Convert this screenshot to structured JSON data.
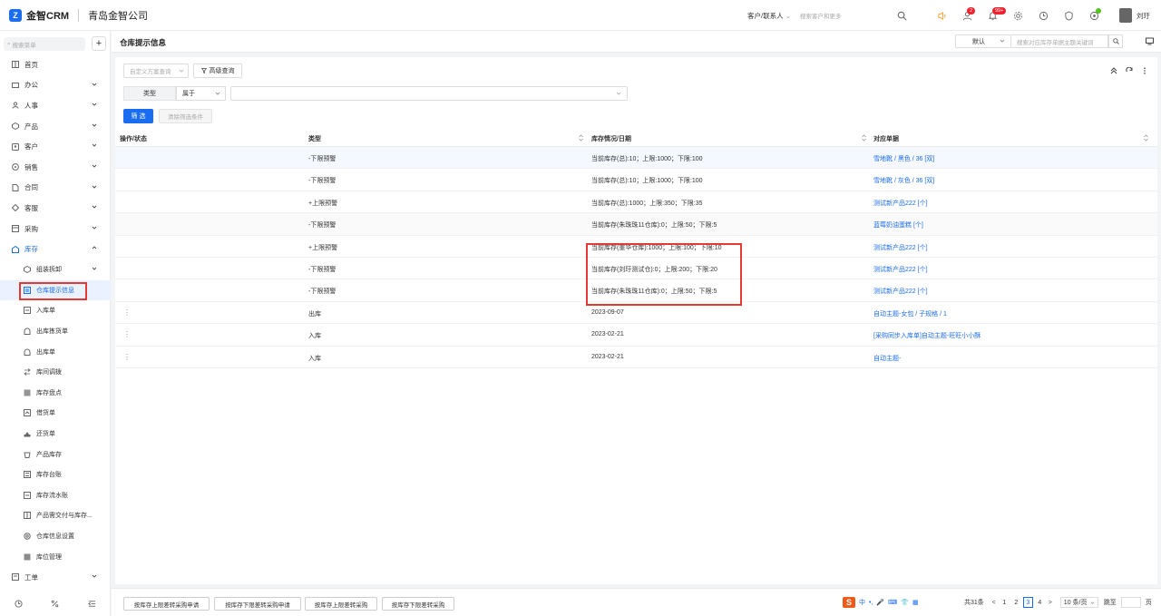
{
  "app": {
    "logo_letter": "Z",
    "brand": "金智CRM",
    "company": "青岛金智公司"
  },
  "topbar": {
    "customer_select": "客户/联系人",
    "search_placeholder": "搜索客户和更多",
    "badge_contacts": "2",
    "badge_notifications": "99+",
    "user_name": "刘玗"
  },
  "sidebar": {
    "search_placeholder": "搜索菜单",
    "plus": "+",
    "items": [
      {
        "label": "首页",
        "icon": "home-icon"
      },
      {
        "label": "办公",
        "icon": "mail-icon"
      },
      {
        "label": "人事",
        "icon": "people-icon"
      },
      {
        "label": "产品",
        "icon": "box-icon"
      },
      {
        "label": "客户",
        "icon": "contact-icon"
      },
      {
        "label": "销售",
        "icon": "sales-icon"
      },
      {
        "label": "合同",
        "icon": "contract-icon"
      },
      {
        "label": "客服",
        "icon": "service-icon"
      },
      {
        "label": "采购",
        "icon": "cart-icon"
      },
      {
        "label": "库存",
        "icon": "warehouse-icon"
      }
    ],
    "sub_items": [
      {
        "label": "组装拆卸",
        "icon": "assembly-icon"
      },
      {
        "label": "仓库提示信息",
        "icon": "alert-doc-icon"
      },
      {
        "label": "入库单",
        "icon": "inbound-icon"
      },
      {
        "label": "出库拣货单",
        "icon": "picking-icon"
      },
      {
        "label": "出库单",
        "icon": "outbound-icon"
      },
      {
        "label": "库间调拨",
        "icon": "transfer-icon"
      },
      {
        "label": "库存盘点",
        "icon": "stocktake-icon"
      },
      {
        "label": "借货单",
        "icon": "borrow-icon"
      },
      {
        "label": "还货单",
        "icon": "return-icon"
      },
      {
        "label": "产品库存",
        "icon": "product-stock-icon"
      },
      {
        "label": "库存台账",
        "icon": "ledger-icon"
      },
      {
        "label": "库存流水账",
        "icon": "journal-icon"
      },
      {
        "label": "产品需交付与库存...",
        "icon": "delivery-icon"
      },
      {
        "label": "仓库信息设置",
        "icon": "settings-icon"
      },
      {
        "label": "库位管理",
        "icon": "location-icon"
      }
    ],
    "last_item": {
      "label": "工单",
      "icon": "ticket-icon"
    }
  },
  "page": {
    "title": "仓库提示信息",
    "view_select": "默认",
    "search_placeholder": "搜索对应库存单据主题关键词",
    "custom_scheme_placeholder": "自定义方案查询",
    "advanced_query": "高级查询",
    "condition": {
      "field": "类型",
      "operator": "属于",
      "value": ""
    },
    "filter_button": "筛 选",
    "clear_button": "清除筛选条件"
  },
  "table": {
    "headers": [
      "操作/状态",
      "类型",
      "库存情况/日期",
      "对应单据"
    ],
    "rows": [
      {
        "action": "",
        "type": "-下限预警",
        "status": "当前库存(总):10；上限:1000；下限:100",
        "doc": "雪地靴 / 黑色 / 36 [双]"
      },
      {
        "action": "",
        "type": "-下限预警",
        "status": "当前库存(总):10；上限:1000；下限:100",
        "doc": "雪地靴 / 灰色 / 36 [双]"
      },
      {
        "action": "",
        "type": "+上限预警",
        "status": "当前库存(总):1000；上限:350；下限:35",
        "doc": "测试新产品222 [个]"
      },
      {
        "action": "",
        "type": "-下限预警",
        "status": "当前库存(朱珠珠11仓库):0；上限:50；下限:5",
        "doc": "蓝莓奶油蛋糕 [个]"
      },
      {
        "action": "",
        "type": "+上限预警",
        "status": "当前库存(重华仓库):1000；上限:100；下限:10",
        "doc": "测试新产品222 [个]"
      },
      {
        "action": "",
        "type": "-下限预警",
        "status": "当前库存(刘玗测试仓):0；上限:200；下限:20",
        "doc": "测试新产品222 [个]"
      },
      {
        "action": "",
        "type": "-下限预警",
        "status": "当前库存(朱珠珠11仓库):0；上限:50；下限:5",
        "doc": "测试新产品222 [个]"
      },
      {
        "action": "⋮",
        "type": "出库",
        "status": "2023-09-07",
        "doc": "自动主题-女包 / 子规格 / 1"
      },
      {
        "action": "⋮",
        "type": "入库",
        "status": "2023-02-21",
        "doc": "[采购同步入库单]自动主题-旺旺小小酥"
      },
      {
        "action": "⋮",
        "type": "入库",
        "status": "2023-02-21",
        "doc": "自动主题-"
      }
    ]
  },
  "footer": {
    "buttons": [
      "按库存上限差转采购申请",
      "按库存下限差转采购申请",
      "按库存上限差转采购",
      "按库存下限差转采购"
    ],
    "ime": {
      "logo": "S",
      "lang": "中",
      "punct": "•,"
    },
    "pager": {
      "total": "共31条",
      "prev": "<",
      "pages": [
        "1",
        "2",
        "3",
        "4"
      ],
      "current": "3",
      "next": ">",
      "page_size": "10 条/页",
      "goto_label": "跳至",
      "page_unit": "页"
    }
  },
  "colors": {
    "accent": "#1a6cf0",
    "highlight": "#e53935"
  }
}
